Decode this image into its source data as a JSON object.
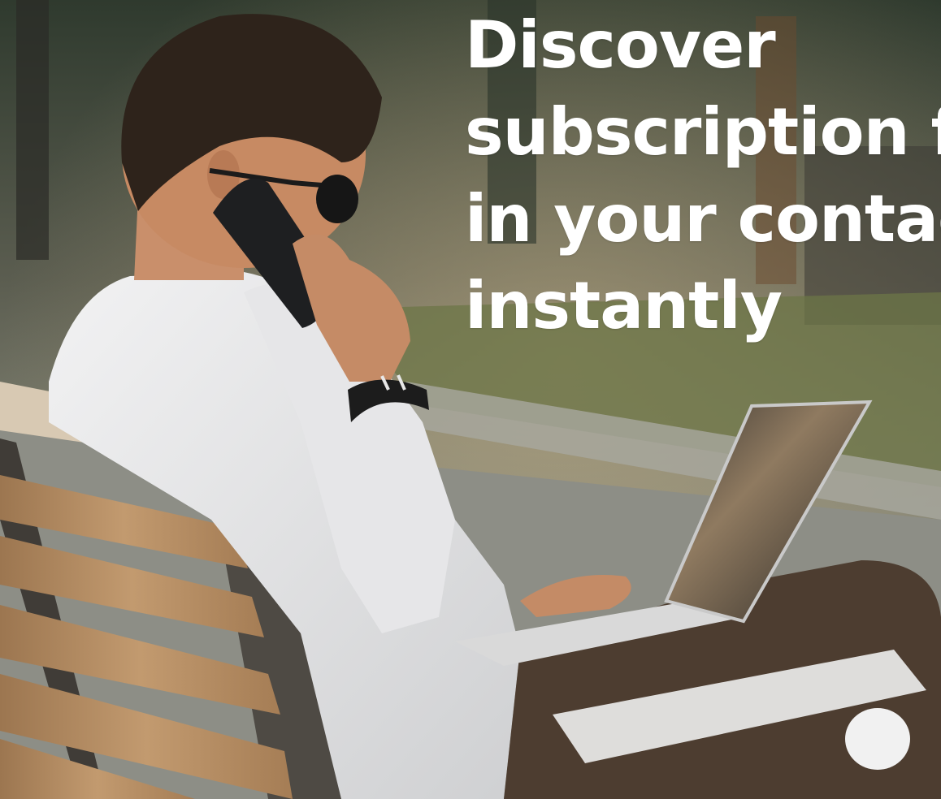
{
  "hero": {
    "headline": "Discover\nsubscription from\nin your contacts\ninstantly",
    "image_description_name": "man-on-bench-phone-laptop-photo"
  },
  "colors": {
    "headline": "#ffffff",
    "bench_wood": "#b08a62",
    "bench_frame": "#4e4a44",
    "shirt": "#e9e9ea",
    "pants": "#4d3d30",
    "phone": "#1e1f21",
    "laptop": "#d9d9d9",
    "grass": "#5f6a3f",
    "pavement": "#8d8e86"
  }
}
